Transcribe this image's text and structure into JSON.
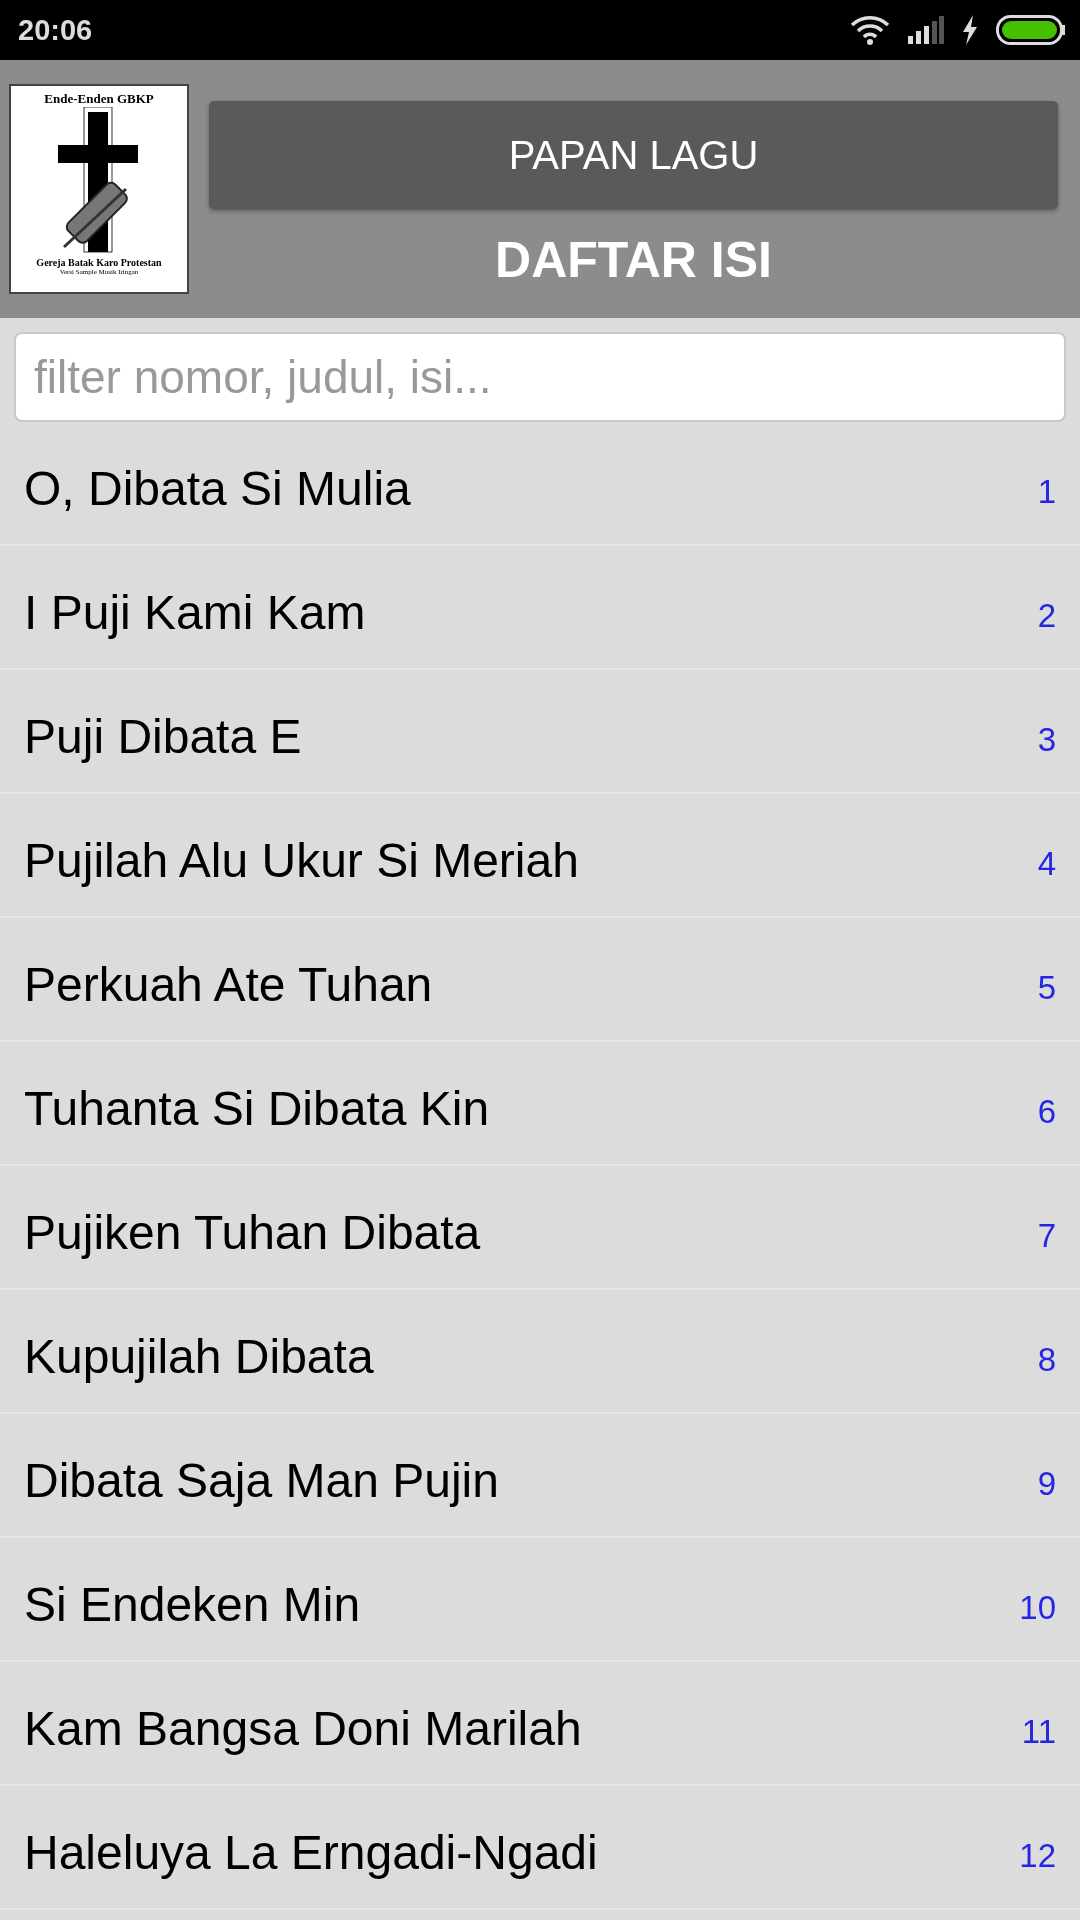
{
  "status_bar": {
    "time": "20:06"
  },
  "logo": {
    "title": "Ende-Enden GBKP",
    "subtitle": "Gereja Batak Karo Protestan",
    "caption": "Versi Sample Musik Iringan"
  },
  "header": {
    "button": "PAPAN LAGU",
    "title": "DAFTAR ISI"
  },
  "search": {
    "placeholder": "filter nomor, judul, isi..."
  },
  "songs": [
    {
      "title": "O, Dibata Si Mulia",
      "number": "1"
    },
    {
      "title": "I Puji Kami Kam",
      "number": "2"
    },
    {
      "title": "Puji Dibata E",
      "number": "3"
    },
    {
      "title": "Pujilah Alu Ukur Si Meriah",
      "number": "4"
    },
    {
      "title": "Perkuah Ate Tuhan",
      "number": "5"
    },
    {
      "title": "Tuhanta Si Dibata Kin",
      "number": "6"
    },
    {
      "title": "Pujiken Tuhan Dibata",
      "number": "7"
    },
    {
      "title": "Kupujilah Dibata",
      "number": "8"
    },
    {
      "title": "Dibata Saja Man Pujin",
      "number": "9"
    },
    {
      "title": "Si Endeken Min",
      "number": "10"
    },
    {
      "title": "Kam Bangsa Doni Marilah",
      "number": "11"
    },
    {
      "title": "Haleluya La Erngadi-Ngadi",
      "number": "12"
    }
  ]
}
